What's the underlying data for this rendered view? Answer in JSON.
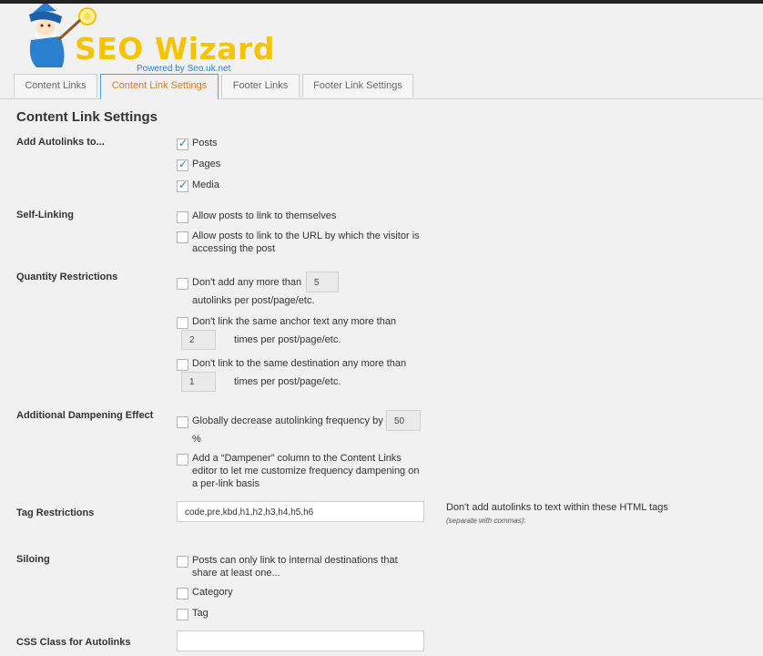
{
  "logo": {
    "brand": "SEO Wizard",
    "powered": "Powered by Seo.uk.net"
  },
  "tabs": [
    {
      "label": "Content Links"
    },
    {
      "label": "Content Link Settings"
    },
    {
      "label": "Footer Links"
    },
    {
      "label": "Footer Link Settings"
    }
  ],
  "page_title": "Content Link Settings",
  "autolinks": {
    "label": "Add Autolinks to...",
    "options": [
      {
        "label": "Posts",
        "checked": true
      },
      {
        "label": "Pages",
        "checked": true
      },
      {
        "label": "Media",
        "checked": true
      }
    ]
  },
  "self_linking": {
    "label": "Self-Linking",
    "opt1": "Allow posts to link to themselves",
    "opt2_line1": "Allow posts to link to the URL by which the visitor is",
    "opt2_line2": "accessing the post"
  },
  "quantity": {
    "label": "Quantity Restrictions",
    "opt1_a": "Don't add any more than",
    "opt1_value": "5",
    "opt1_b": "autolinks per post/page/etc.",
    "opt2_a": "Don't link the same anchor text any more than",
    "opt2_value": "2",
    "opt2_b": "times per post/page/etc.",
    "opt3_a": "Don't link to the same destination any more than",
    "opt3_value": "1",
    "opt3_b": "times per post/page/etc."
  },
  "dampening": {
    "label": "Additional Dampening Effect",
    "opt1_a": "Globally decrease autolinking frequency by",
    "opt1_value": "50",
    "opt1_b": "%",
    "opt2_line1": "Add a “Dampener” column to the Content Links",
    "opt2_line2": "editor to let me customize frequency dampening on",
    "opt2_line3": "a per-link basis"
  },
  "tags": {
    "label": "Tag Restrictions",
    "value": "code,pre,kbd,h1,h2,h3,h4,h5,h6",
    "hint": "Don't add autolinks to text within these HTML tags",
    "hint_small": "(separate with commas):"
  },
  "siloing": {
    "label": "Siloing",
    "opt1_line1": "Posts can only link to internal destinations that",
    "opt1_line2": "share at least one...",
    "opt2": "Category",
    "opt3": "Tag"
  },
  "css_class": {
    "label": "CSS Class for Autolinks",
    "value": ""
  },
  "colors": {
    "brand": "#f5c400",
    "tab_active": "#d57d1b",
    "tab_border_active": "#4da3d6",
    "check": "#1e7ec8"
  }
}
